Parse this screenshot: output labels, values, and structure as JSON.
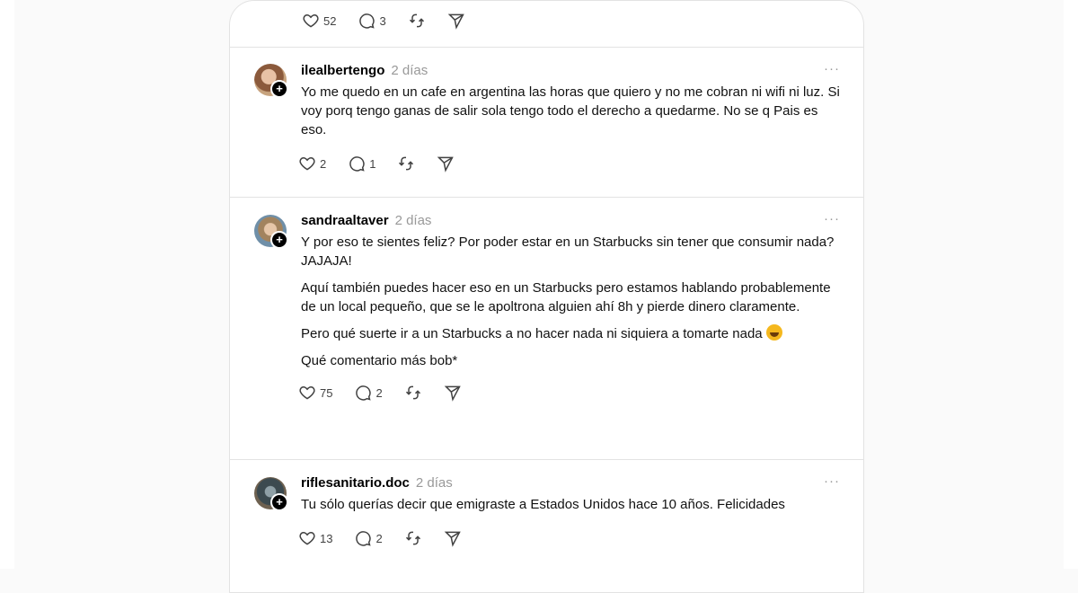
{
  "top_post": {
    "likes": "52",
    "comments": "3"
  },
  "posts": [
    {
      "username": "ilealbertengo",
      "time": "2 días",
      "more": "···",
      "paragraphs": [
        "Yo me quedo en un cafe en argentina las horas que quiero y no me cobran ni wifi ni luz. Si voy porq tengo ganas de salir sola tengo todo el derecho a quedarme. No se q Pais es eso."
      ],
      "likes": "2",
      "comments": "1"
    },
    {
      "username": "sandraaltaver",
      "time": "2 días",
      "more": "···",
      "paragraphs": [
        "Y por eso te sientes feliz? Por poder estar en un Starbucks sin tener que consumir nada? JAJAJA!",
        "Aquí también puedes hacer eso en un Starbucks pero estamos hablando probablemente de un local pequeño, que se le apoltrona alguien ahí 8h y pierde dinero claramente.",
        "Pero qué suerte ir a un Starbucks a no hacer nada ni siquiera a tomarte nada",
        "Qué comentario más bob*"
      ],
      "emoji": "laughing-face-emoji",
      "likes": "75",
      "comments": "2"
    },
    {
      "username": "riflesanitario.doc",
      "time": "2 días",
      "more": "···",
      "paragraphs": [
        "Tu sólo querías decir que emigraste a Estados Unidos hace 10 años. Felicidades"
      ],
      "likes": "13",
      "comments": "2"
    }
  ],
  "colors": {
    "background": "#fafafa",
    "card": "#ffffff",
    "border": "#e3e3e3",
    "muted": "#999999",
    "icon": "#424242"
  }
}
